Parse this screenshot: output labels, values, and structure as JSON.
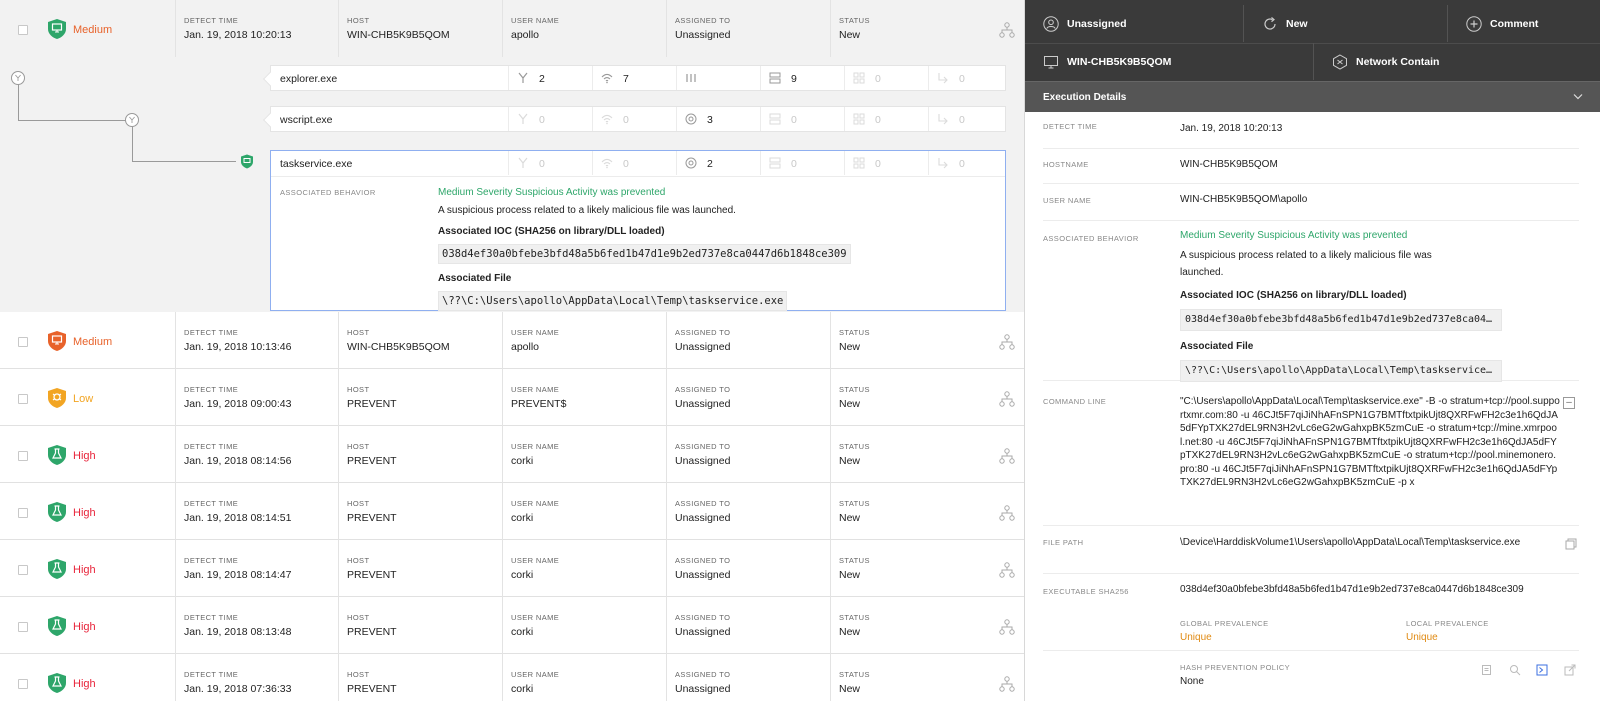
{
  "colors": {
    "medium": "#e8622a",
    "low": "#f2a523",
    "high": "#e8243a",
    "badge_green": "#2ea66a",
    "prevalence": "#e08a12",
    "link_blue": "#3b6fe0"
  },
  "column_headers": {
    "detect_time": "DETECT TIME",
    "host": "HOST",
    "user_name": "USER NAME",
    "assigned_to": "ASSIGNED TO",
    "status": "STATUS"
  },
  "detections": [
    {
      "severity": "Medium",
      "severity_class": "medium",
      "badge_color": "#2ea66a",
      "icon": "monitor-shield-icon",
      "detect_time": "Jan. 19, 2018 10:20:13",
      "host": "WIN-CHB5K9B5QOM",
      "user_name": "apollo",
      "assigned_to": "Unassigned",
      "status": "New"
    },
    {
      "severity": "Medium",
      "severity_class": "medium",
      "badge_color": "#e8622a",
      "icon": "monitor-shield-icon",
      "detect_time": "Jan. 19, 2018 10:13:46",
      "host": "WIN-CHB5K9B5QOM",
      "user_name": "apollo",
      "assigned_to": "Unassigned",
      "status": "New"
    },
    {
      "severity": "Low",
      "severity_class": "low",
      "badge_color": "#f2a523",
      "icon": "bug-shield-icon",
      "detect_time": "Jan. 19, 2018 09:00:43",
      "host": "PREVENT",
      "user_name": "PREVENT$",
      "assigned_to": "Unassigned",
      "status": "New"
    },
    {
      "severity": "High",
      "severity_class": "high",
      "badge_color": "#2ea66a",
      "icon": "flask-shield-icon",
      "detect_time": "Jan. 19, 2018 08:14:56",
      "host": "PREVENT",
      "user_name": "corki",
      "assigned_to": "Unassigned",
      "status": "New"
    },
    {
      "severity": "High",
      "severity_class": "high",
      "badge_color": "#2ea66a",
      "icon": "flask-shield-icon",
      "detect_time": "Jan. 19, 2018 08:14:51",
      "host": "PREVENT",
      "user_name": "corki",
      "assigned_to": "Unassigned",
      "status": "New"
    },
    {
      "severity": "High",
      "severity_class": "high",
      "badge_color": "#2ea66a",
      "icon": "flask-shield-icon",
      "detect_time": "Jan. 19, 2018 08:14:47",
      "host": "PREVENT",
      "user_name": "corki",
      "assigned_to": "Unassigned",
      "status": "New"
    },
    {
      "severity": "High",
      "severity_class": "high",
      "badge_color": "#2ea66a",
      "icon": "flask-shield-icon",
      "detect_time": "Jan. 19, 2018 08:13:48",
      "host": "PREVENT",
      "user_name": "corki",
      "assigned_to": "Unassigned",
      "status": "New"
    },
    {
      "severity": "High",
      "severity_class": "high",
      "badge_color": "#2ea66a",
      "icon": "flask-shield-icon",
      "detect_time": "Jan. 19, 2018 07:36:33",
      "host": "PREVENT",
      "user_name": "corki",
      "assigned_to": "Unassigned",
      "status": "New"
    }
  ],
  "process_tree": [
    {
      "name": "explorer.exe",
      "stats": [
        "2",
        "7",
        "",
        "9",
        "0",
        "0"
      ]
    },
    {
      "name": "wscript.exe",
      "stats": [
        "0",
        "0",
        "3",
        "0",
        "0",
        "0"
      ]
    },
    {
      "name": "taskservice.exe",
      "stats": [
        "0",
        "0",
        "2",
        "0",
        "0",
        "0"
      ]
    }
  ],
  "process_stat_icons": [
    "fork-icon",
    "network-icon",
    "dns-icon",
    "disk-icon",
    "registry-icon",
    "network-connect-icon"
  ],
  "process_detail": {
    "label": "ASSOCIATED BEHAVIOR",
    "title": "Medium Severity Suspicious Activity was prevented",
    "description": "A suspicious process related to a likely malicious file was launched.",
    "ioc_label": "Associated IOC (SHA256 on library/DLL loaded)",
    "ioc_value": "038d4ef30a0bfebe3bfd48a5b6fed1b47d1e9b2ed737e8ca0447d6b1848ce309",
    "file_label": "Associated File",
    "file_value": "\\??\\C:\\Users\\apollo\\AppData\\Local\\Temp\\taskservice.exe"
  },
  "actions": {
    "assign": "Unassigned",
    "status": "New",
    "comment": "Comment",
    "host": "WIN-CHB5K9B5QOM",
    "contain": "Network Contain"
  },
  "execution_details": {
    "header": "Execution Details",
    "detect_time_label": "DETECT TIME",
    "detect_time": "Jan. 19, 2018 10:20:13",
    "hostname_label": "HOSTNAME",
    "hostname": "WIN-CHB5K9B5QOM",
    "user_label": "USER NAME",
    "user": "WIN-CHB5K9B5QOM\\apollo",
    "behavior_label": "ASSOCIATED BEHAVIOR",
    "behavior_title": "Medium Severity Suspicious Activity was prevented",
    "behavior_desc": "A suspicious process related to a likely malicious file was launched.",
    "ioc_label": "Associated IOC (SHA256 on library/DLL loaded)",
    "ioc_value": "038d4ef30a0bfebe3bfd48a5b6fed1b47d1e9b2ed737e8ca04…",
    "file_label": "Associated File",
    "file_value": "\\??\\C:\\Users\\apollo\\AppData\\Local\\Temp\\taskservice…",
    "command_label": "COMMAND LINE",
    "command_line": "\"C:\\Users\\apollo\\AppData\\Local\\Temp\\taskservice.exe\" -B -o stratum+tcp://pool.supportxmr.com:80 -u 46CJt5F7qiJiNhAFnSPN1G7BMTftxtpikUjt8QXRFwFH2c3e1h6QdJA5dFYpTXK27dEL9RN3H2vLc6eG2wGahxpBK5zmCuE -o stratum+tcp://mine.xmrpool.net:80 -u 46CJt5F7qiJiNhAFnSPN1G7BMTftxtpikUjt8QXRFwFH2c3e1h6QdJA5dFYpTXK27dEL9RN3H2vLc6eG2wGahxpBK5zmCuE -o stratum+tcp://pool.minemonero.pro:80 -u 46CJt5F7qiJiNhAFnSPN1G7BMTftxtpikUjt8QXRFwFH2c3e1h6QdJA5dFYpTXK27dEL9RN3H2vLc6eG2wGahxpBK5zmCuE -p x",
    "file_path_label": "FILE PATH",
    "file_path": "\\Device\\HarddiskVolume1\\Users\\apollo\\AppData\\Local\\Temp\\taskservice.exe",
    "sha_label": "EXECUTABLE SHA256",
    "sha": "038d4ef30a0bfebe3bfd48a5b6fed1b47d1e9b2ed737e8ca0447d6b1848ce309",
    "global_prev_label": "GLOBAL PREVALENCE",
    "global_prev": "Unique",
    "local_prev_label": "LOCAL PREVALENCE",
    "local_prev": "Unique",
    "hash_policy_label": "HASH PREVENTION POLICY",
    "hash_policy": "None"
  }
}
